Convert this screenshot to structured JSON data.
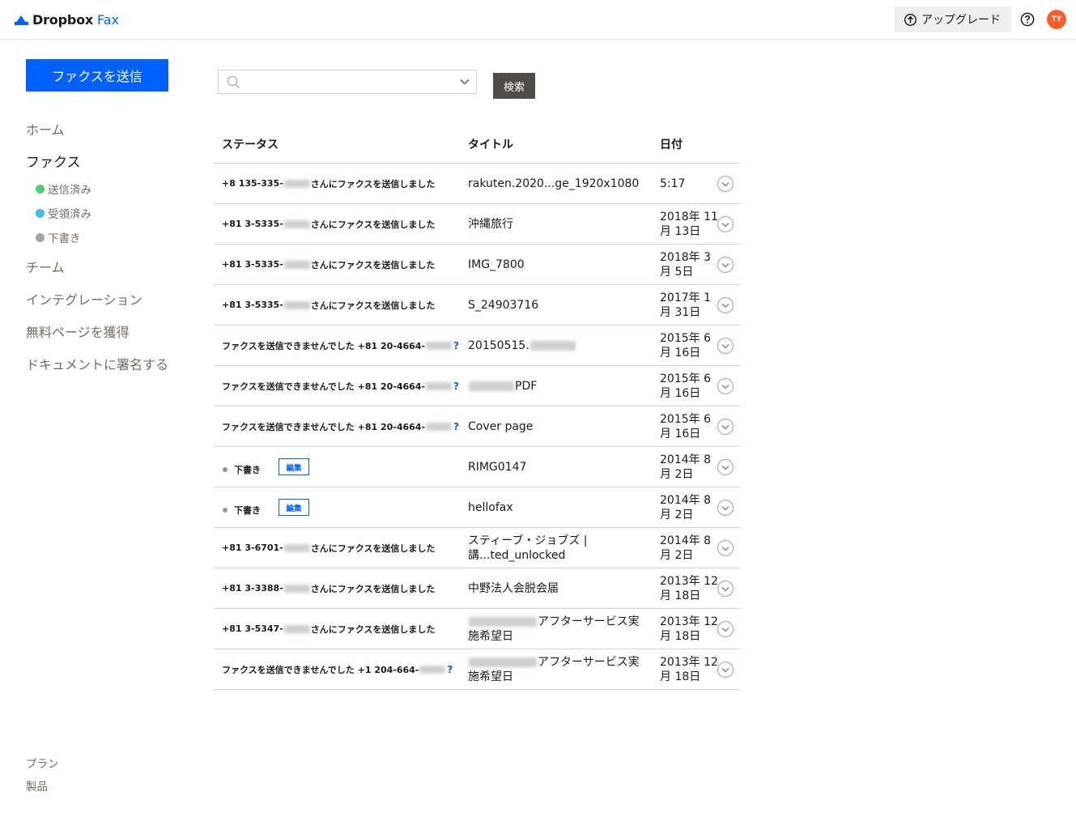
{
  "header": {
    "brand": "Dropbox",
    "product": "Fax",
    "upgrade_label": "アップグレード",
    "avatar_initials": "TY"
  },
  "sidebar": {
    "send_fax_label": "ファクスを送信",
    "home": "ホーム",
    "fax": "ファクス",
    "sub_items": [
      {
        "label": "送信済み",
        "color": "#4fcf70"
      },
      {
        "label": "受領済み",
        "color": "#3fc1e8"
      },
      {
        "label": "下書き",
        "color": "#a7a29d"
      }
    ],
    "team": "チーム",
    "integration": "インテグレーション",
    "free_pages": "無料ページを獲得",
    "sign_document": "ドキュメントに署名する",
    "footer": {
      "plan": "プラン",
      "products": "製品"
    }
  },
  "search": {
    "placeholder": "",
    "button_label": "検索"
  },
  "table": {
    "headers": {
      "status": "ステータス",
      "title": "タイトル",
      "date": "日付"
    },
    "rows": [
      {
        "status_prefix": "+8 135-335-",
        "status_suffix": "さんにファクスを送信しました",
        "title": "rakuten.2020...ge_1920x1080",
        "date": "5:17"
      },
      {
        "status_prefix": "+81 3-5335-",
        "status_suffix": "さんにファクスを送信しました",
        "title": "沖縄旅行",
        "date": "2018年 11 月 13日"
      },
      {
        "status_prefix": "+81 3-5335-",
        "status_suffix": "さんにファクスを送信しました",
        "title": "IMG_7800",
        "date": "2018年 3 月 5日"
      },
      {
        "status_prefix": "+81 3-5335-",
        "status_suffix": "さんにファクスを送信しました",
        "title": "S_24903716",
        "date": "2017年 1月 31日"
      },
      {
        "status_prefix": "ファクスを送信できませんでした +81 20-4664-",
        "status_suffix": "?",
        "title": "20150515.",
        "date": "2015年 6 月 16日"
      },
      {
        "status_prefix": "ファクスを送信できませんでした +81 20-4664-",
        "status_suffix": "?",
        "title": "PDF",
        "date": "2015年 6 月 16日"
      },
      {
        "status_prefix": "ファクスを送信できませんでした +81 20-4664-",
        "status_suffix": "?",
        "title": "Cover page",
        "date": "2015年 6 月 16日"
      },
      {
        "status_prefix": "下書き",
        "status_suffix": "",
        "edit_label": "編集",
        "title": "RIMG0147",
        "date": "2014年 8 月 2日"
      },
      {
        "status_prefix": "下書き",
        "status_suffix": "",
        "edit_label": "編集",
        "title": "hellofax",
        "date": "2014年 8 月 2日"
      },
      {
        "status_prefix": "+81 3-6701-",
        "status_suffix": "さんにファクスを送信しました",
        "title": "スティーブ・ジョブズ | 講...ted_unlocked",
        "date": "2014年 8 月 2日"
      },
      {
        "status_prefix": "+81 3-3388-",
        "status_suffix": "さんにファクスを送信しました",
        "title": "中野法人会脱会届",
        "date": "2013年 12 月 18日"
      },
      {
        "status_prefix": "+81 3-5347-",
        "status_suffix": "さんにファクスを送信しました",
        "title": "アフターサービス実施希望日",
        "date": "2013年 12 月 18日"
      },
      {
        "status_prefix": "ファクスを送信できませんでした +1 204-664-",
        "status_suffix": "?",
        "title": "アフターサービス実施希望日",
        "date": "2013年 12 月 18日"
      }
    ]
  }
}
